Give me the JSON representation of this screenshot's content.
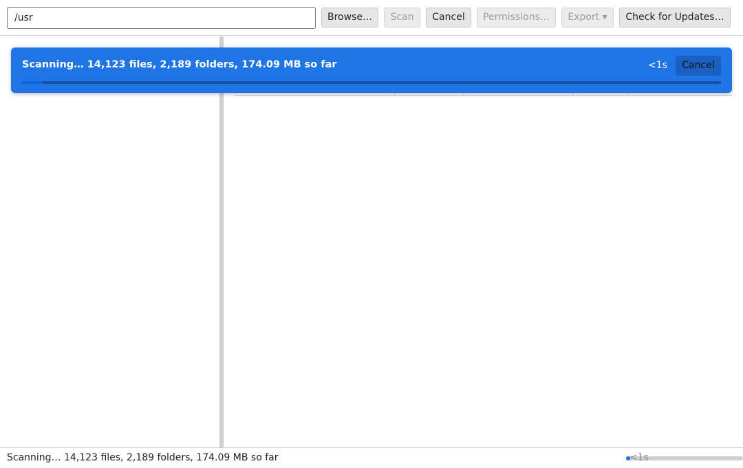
{
  "toolbar": {
    "path_value": "/usr",
    "browse_label": "Browse…",
    "scan_label": "Scan",
    "cancel_label": "Cancel",
    "permissions_label": "Permissions…",
    "export_label": "Export ▾",
    "updates_label": "Check for Updates…"
  },
  "banner": {
    "message": "Scanning… 14,123 files, 2,189 folders, 174.09 MB so far",
    "eta": "<1s",
    "cancel_label": "Cancel",
    "progress_fraction": 0.03,
    "color": "#1f75e6"
  },
  "statusbar": {
    "message": "Scanning… 14,123 files, 2,189 folders, 174.09 MB so far",
    "eta": "<1s",
    "progress_fraction": 0.0
  }
}
